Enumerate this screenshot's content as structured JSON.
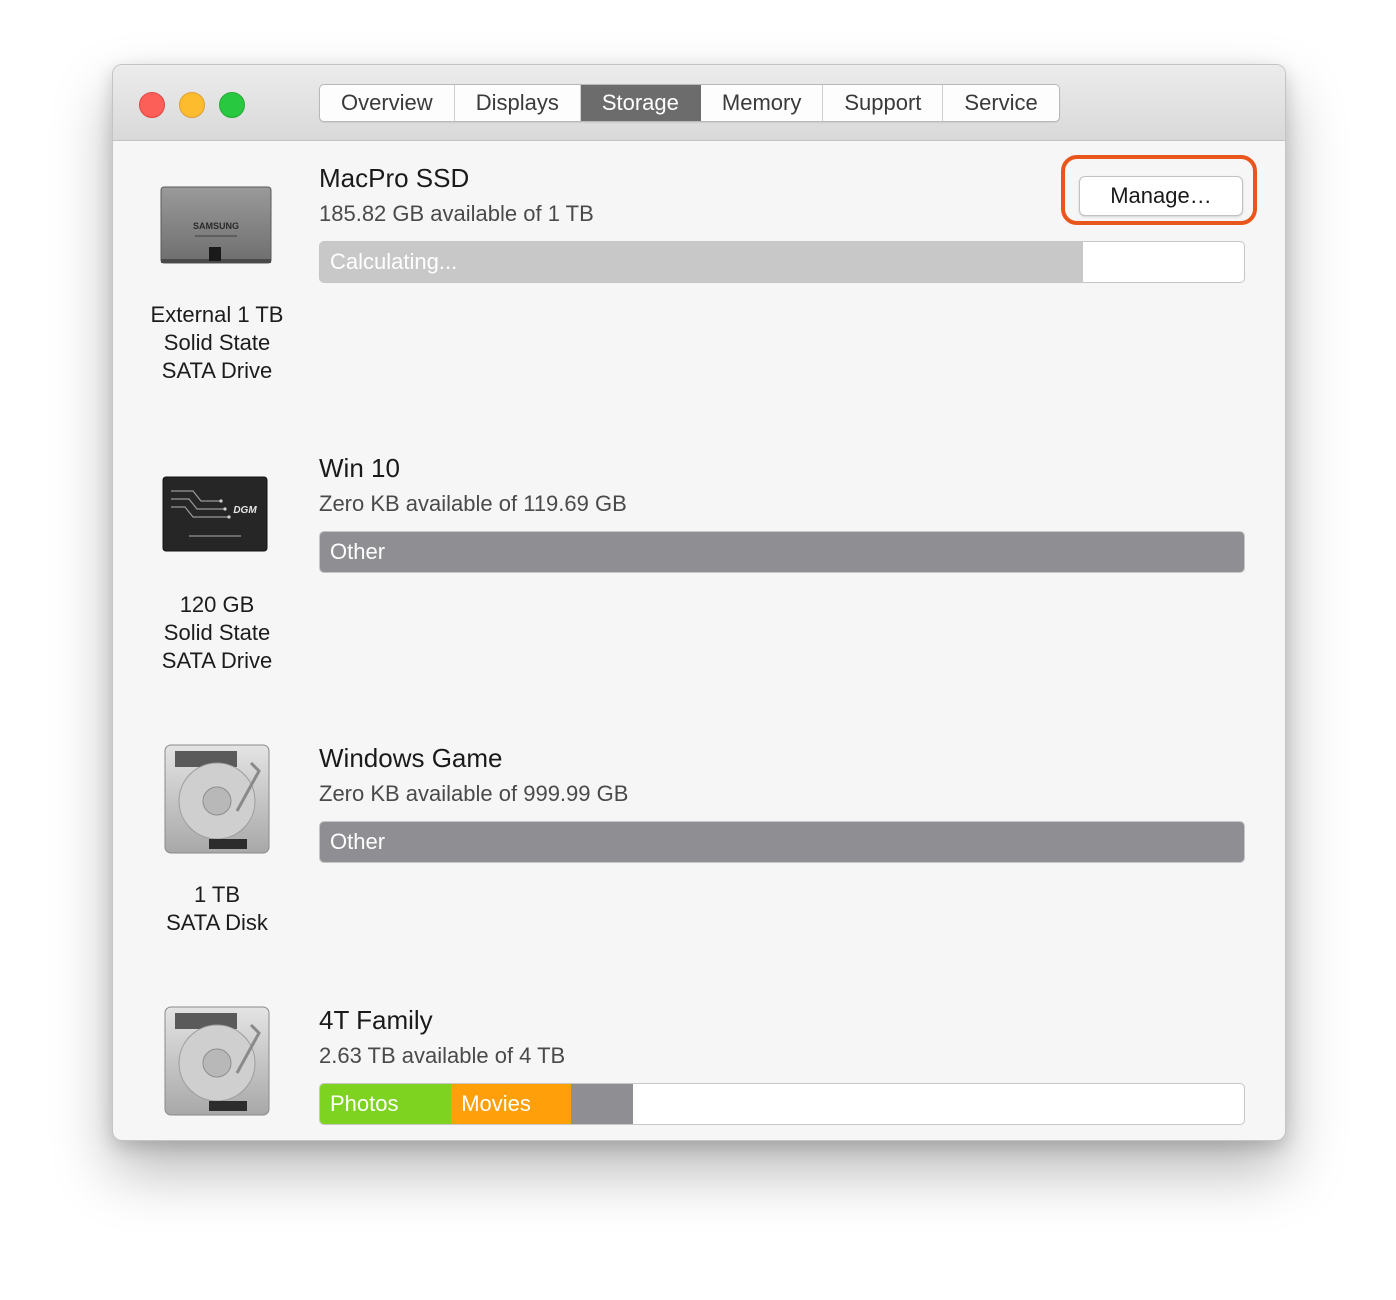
{
  "window": {
    "tabs": [
      {
        "label": "Overview",
        "active": false
      },
      {
        "label": "Displays",
        "active": false
      },
      {
        "label": "Storage",
        "active": true
      },
      {
        "label": "Memory",
        "active": false
      },
      {
        "label": "Support",
        "active": false
      },
      {
        "label": "Service",
        "active": false
      }
    ],
    "manage_label": "Manage…"
  },
  "colors": {
    "accent_highlight": "#e8561c",
    "photos": "#7ed321",
    "movies": "#ff9f0a",
    "other": "#8e8e93",
    "calculating": "#c8c8c8",
    "active_tab": "#6c6c6c"
  },
  "drives": [
    {
      "icon": "ssd-samsung-icon",
      "icon_brand": "SAMSUNG",
      "desc": [
        "External 1 TB",
        "Solid State",
        "SATA Drive"
      ],
      "name": "MacPro SSD",
      "available": "185.82 GB available of 1 TB",
      "segments": [
        {
          "label": "Calculating...",
          "fraction": 0.826,
          "color": "#c8c8c8"
        }
      ]
    },
    {
      "icon": "ssd-dgm-icon",
      "icon_brand": "DGM",
      "desc": [
        "120 GB",
        "Solid State",
        "SATA Drive"
      ],
      "name": "Win 10",
      "available": "Zero KB available of 119.69 GB",
      "segments": [
        {
          "label": "Other",
          "fraction": 1.0,
          "color": "#8e8e93"
        }
      ]
    },
    {
      "icon": "hard-disk-icon",
      "desc": [
        "1 TB",
        "SATA Disk"
      ],
      "name": "Windows Game",
      "available": "Zero KB available of 999.99 GB",
      "segments": [
        {
          "label": "Other",
          "fraction": 1.0,
          "color": "#8e8e93"
        }
      ]
    },
    {
      "icon": "hard-disk-icon",
      "desc": [],
      "name": "4T Family",
      "available": "2.63 TB available of 4 TB",
      "segments": [
        {
          "label": "Photos",
          "fraction": 0.142,
          "color": "#7ed321"
        },
        {
          "label": "Movies",
          "fraction": 0.13,
          "color": "#ff9f0a"
        },
        {
          "label": "",
          "fraction": 0.067,
          "color": "#8e8e93"
        }
      ]
    }
  ]
}
